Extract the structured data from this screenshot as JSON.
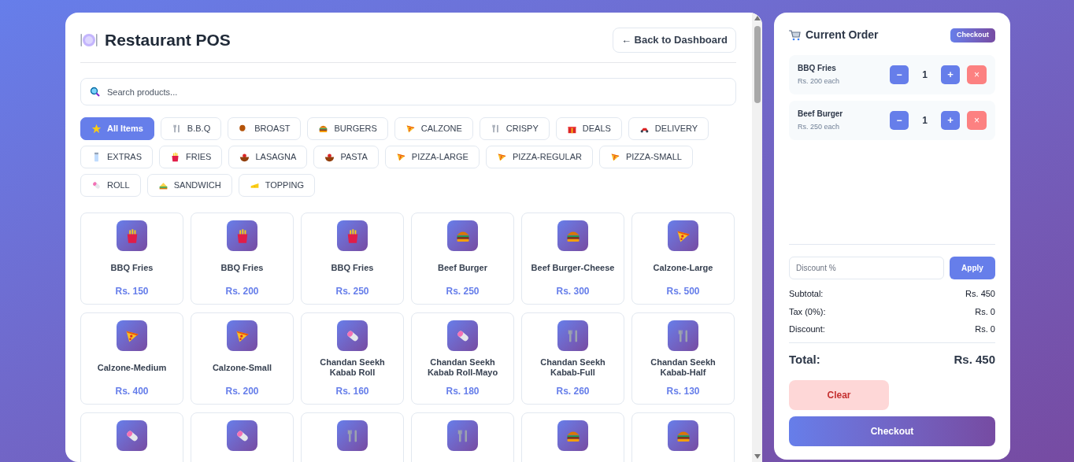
{
  "header": {
    "title": "Restaurant POS",
    "back_button": "← Back to Dashboard"
  },
  "search": {
    "placeholder": "Search products..."
  },
  "categories": [
    {
      "label": "All Items",
      "kind": "star",
      "selected": true
    },
    {
      "label": "B.B.Q",
      "kind": "utensils",
      "selected": false
    },
    {
      "label": "BROAST",
      "kind": "drumstick",
      "selected": false
    },
    {
      "label": "BURGERS",
      "kind": "burger",
      "selected": false
    },
    {
      "label": "CALZONE",
      "kind": "pizza",
      "selected": false
    },
    {
      "label": "CRISPY",
      "kind": "utensils",
      "selected": false
    },
    {
      "label": "DEALS",
      "kind": "gift",
      "selected": false
    },
    {
      "label": "DELIVERY",
      "kind": "scooter",
      "selected": false
    },
    {
      "label": "EXTRAS",
      "kind": "shaker",
      "selected": false
    },
    {
      "label": "FRIES",
      "kind": "fries",
      "selected": false
    },
    {
      "label": "LASAGNA",
      "kind": "bowl",
      "selected": false
    },
    {
      "label": "PASTA",
      "kind": "bowl",
      "selected": false
    },
    {
      "label": "PIZZA-LARGE",
      "kind": "pizza",
      "selected": false
    },
    {
      "label": "PIZZA-REGULAR",
      "kind": "pizza",
      "selected": false
    },
    {
      "label": "PIZZA-SMALL",
      "kind": "pizza",
      "selected": false
    },
    {
      "label": "ROLL",
      "kind": "roll",
      "selected": false
    },
    {
      "label": "SANDWICH",
      "kind": "sandwich",
      "selected": false
    },
    {
      "label": "TOPPING",
      "kind": "cheese",
      "selected": false
    }
  ],
  "products": [
    {
      "kind": "fries",
      "name": "BBQ Fries",
      "price": "Rs. 150"
    },
    {
      "kind": "fries",
      "name": "BBQ Fries",
      "price": "Rs. 200"
    },
    {
      "kind": "fries",
      "name": "BBQ Fries",
      "price": "Rs. 250"
    },
    {
      "kind": "burger",
      "name": "Beef Burger",
      "price": "Rs. 250"
    },
    {
      "kind": "burger",
      "name": "Beef Burger-Cheese",
      "price": "Rs. 300"
    },
    {
      "kind": "pizza",
      "name": "Calzone-Large",
      "price": "Rs. 500"
    },
    {
      "kind": "pizza",
      "name": "Calzone-Medium",
      "price": "Rs. 400"
    },
    {
      "kind": "pizza",
      "name": "Calzone-Small",
      "price": "Rs. 200"
    },
    {
      "kind": "roll",
      "name": "Chandan Seekh Kabab Roll",
      "price": "Rs. 160"
    },
    {
      "kind": "roll",
      "name": "Chandan Seekh Kabab Roll-Mayo",
      "price": "Rs. 180"
    },
    {
      "kind": "utensils",
      "name": "Chandan Seekh Kabab-Full",
      "price": "Rs. 260"
    },
    {
      "kind": "utensils",
      "name": "Chandan Seekh Kabab-Half",
      "price": "Rs. 130"
    },
    {
      "kind": "roll"
    },
    {
      "kind": "roll"
    },
    {
      "kind": "utensils"
    },
    {
      "kind": "utensils"
    },
    {
      "kind": "burger"
    },
    {
      "kind": "burger"
    }
  ],
  "order": {
    "title": "Current Order",
    "badge": "Checkout",
    "items": [
      {
        "name": "BBQ Fries",
        "price": "Rs. 200 each",
        "quantity": "1",
        "minus": "−",
        "plus": "+",
        "remove": "×"
      },
      {
        "name": "Beef Burger",
        "price": "Rs. 250 each",
        "quantity": "1",
        "minus": "−",
        "plus": "+",
        "remove": "×"
      }
    ],
    "discount": {
      "placeholder": "Discount %",
      "button": "Apply"
    },
    "summary": [
      {
        "label": "Subtotal:",
        "value": "Rs. 450"
      },
      {
        "label": "Tax (0%):",
        "value": "Rs. 0"
      },
      {
        "label": "Discount:",
        "value": "Rs. 0"
      }
    ],
    "total": {
      "label": "Total:",
      "value": "Rs. 450"
    },
    "clear_button": "Clear",
    "checkout_button": "Checkout"
  }
}
